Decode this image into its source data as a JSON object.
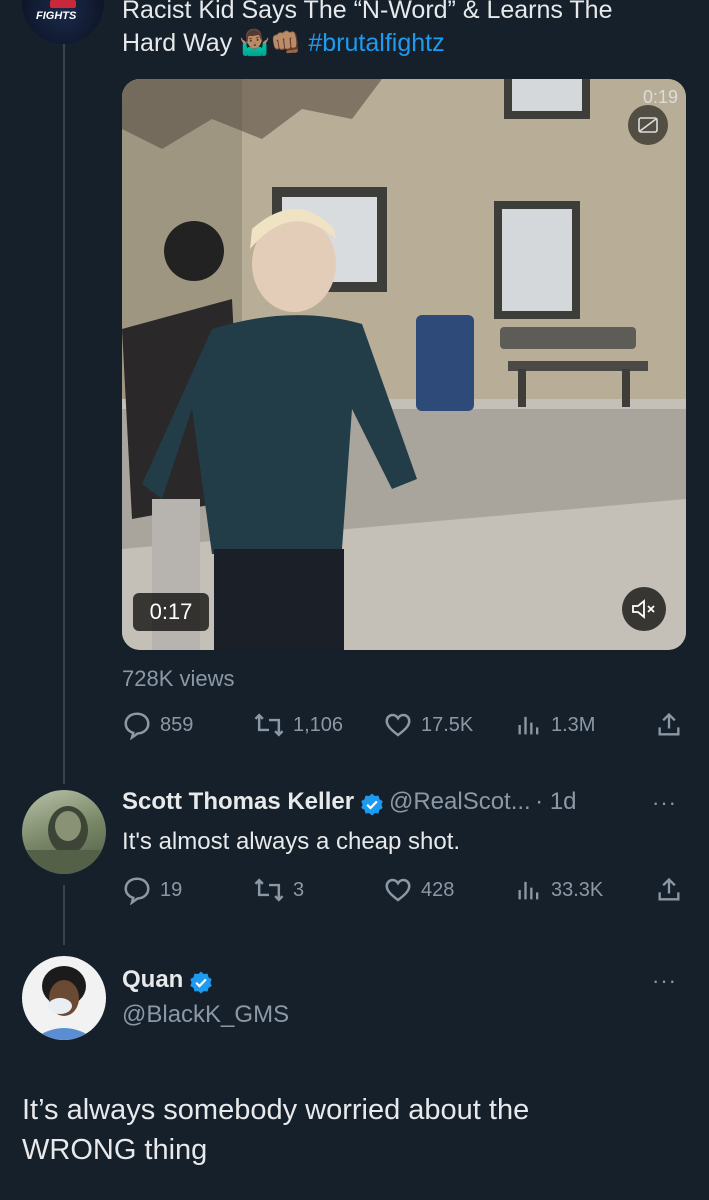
{
  "original_tweet": {
    "title_line1": "Racist Kid Says The “N-Word” & Learns The",
    "title_line2": "Hard Way 🤷🏽‍♂️👊🏽",
    "hashtag": "#brutalfightz",
    "avatar_text": "FIGHTS",
    "video": {
      "elapsed": "0:17",
      "top_counter": "0:19"
    },
    "views": "728K views",
    "actions": {
      "replies": "859",
      "retweets": "1,106",
      "likes": "17.5K",
      "views": "1.3M"
    }
  },
  "reply_tweet": {
    "name": "Scott Thomas Keller",
    "handle": "@RealScot...",
    "time": "· 1d",
    "text": "It's almost always a cheap shot.",
    "actions": {
      "replies": "19",
      "retweets": "3",
      "likes": "428",
      "views": "33.3K"
    }
  },
  "main_tweet": {
    "name": "Quan",
    "handle": "@BlackK_GMS",
    "text_line1": "It’s always somebody worried about the",
    "text_line2": "WRONG thing"
  },
  "more_glyph": "···",
  "colors": {
    "background": "#15202b",
    "accent": "#1d9bf0",
    "muted": "#8b98a5",
    "text": "#e7e9ea"
  }
}
